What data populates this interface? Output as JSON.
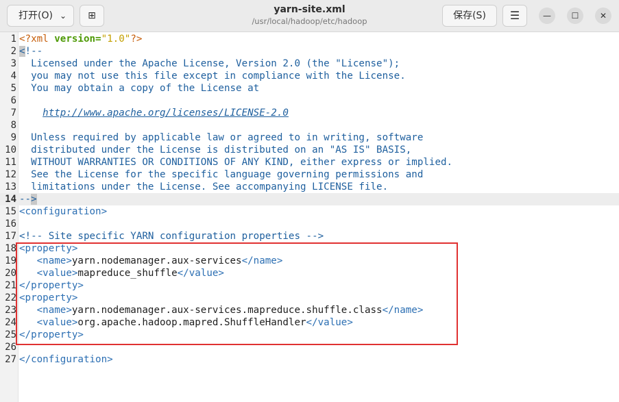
{
  "header": {
    "open_label": "打开(O)",
    "open_chevron": "⌄",
    "newtab_icon": "⊞",
    "title": "yarn-site.xml",
    "subtitle": "/usr/local/hadoop/etc/hadoop",
    "save_label": "保存(S)",
    "menu_icon": "☰",
    "minimize_icon": "—",
    "maximize_icon": "☐",
    "close_icon": "✕"
  },
  "editor": {
    "current_line": 14,
    "lines": [
      {
        "n": "1",
        "tokens": [
          {
            "t": "<?xml ",
            "c": "decl"
          },
          {
            "t": "version=",
            "c": "attr"
          },
          {
            "t": "\"1.0\"",
            "c": "val"
          },
          {
            "t": "?>",
            "c": "decl"
          }
        ]
      },
      {
        "n": "2",
        "tokens": [
          {
            "t": "<",
            "c": "bracket"
          },
          {
            "t": "!--",
            "c": "cmt"
          }
        ]
      },
      {
        "n": "3",
        "tokens": [
          {
            "t": "  Licensed under the Apache License, Version 2.0 (the \"License\");",
            "c": "cmt"
          }
        ]
      },
      {
        "n": "4",
        "tokens": [
          {
            "t": "  you may not use this file except in compliance with the License.",
            "c": "cmt"
          }
        ]
      },
      {
        "n": "5",
        "tokens": [
          {
            "t": "  You may obtain a copy of the License at",
            "c": "cmt"
          }
        ]
      },
      {
        "n": "6",
        "tokens": []
      },
      {
        "n": "7",
        "tokens": [
          {
            "t": "    ",
            "c": "cmt"
          },
          {
            "t": "http://www.apache.org/licenses/LICENSE-2.0",
            "c": "link"
          }
        ]
      },
      {
        "n": "8",
        "tokens": []
      },
      {
        "n": "9",
        "tokens": [
          {
            "t": "  Unless required by applicable law or agreed to in writing, software",
            "c": "cmt"
          }
        ]
      },
      {
        "n": "10",
        "tokens": [
          {
            "t": "  distributed under the License is distributed on an \"AS IS\" BASIS,",
            "c": "cmt"
          }
        ]
      },
      {
        "n": "11",
        "tokens": [
          {
            "t": "  WITHOUT WARRANTIES OR CONDITIONS OF ANY KIND, either express or implied.",
            "c": "cmt"
          }
        ]
      },
      {
        "n": "12",
        "tokens": [
          {
            "t": "  See the License for the specific language governing permissions and",
            "c": "cmt"
          }
        ]
      },
      {
        "n": "13",
        "tokens": [
          {
            "t": "  limitations under the License. See accompanying LICENSE file.",
            "c": "cmt"
          }
        ]
      },
      {
        "n": "14",
        "tokens": [
          {
            "t": "--",
            "c": "cmt"
          },
          {
            "t": ">",
            "c": "bracket"
          }
        ]
      },
      {
        "n": "15",
        "tokens": [
          {
            "t": "<configuration>",
            "c": "tag"
          }
        ]
      },
      {
        "n": "16",
        "tokens": []
      },
      {
        "n": "17",
        "tokens": [
          {
            "t": "<!-- Site specific YARN configuration properties -->",
            "c": "cmt"
          }
        ]
      },
      {
        "n": "18",
        "tokens": [
          {
            "t": "<property>",
            "c": "tag"
          }
        ]
      },
      {
        "n": "19",
        "tokens": [
          {
            "t": "   <name>",
            "c": "tag"
          },
          {
            "t": "yarn.nodemanager.aux-services",
            "c": "plain"
          },
          {
            "t": "</name>",
            "c": "tag"
          }
        ]
      },
      {
        "n": "20",
        "tokens": [
          {
            "t": "   <value>",
            "c": "tag"
          },
          {
            "t": "mapreduce_shuffle",
            "c": "plain"
          },
          {
            "t": "</value>",
            "c": "tag"
          }
        ]
      },
      {
        "n": "21",
        "tokens": [
          {
            "t": "</property>",
            "c": "tag"
          }
        ]
      },
      {
        "n": "22",
        "tokens": [
          {
            "t": "<property>",
            "c": "tag"
          }
        ]
      },
      {
        "n": "23",
        "tokens": [
          {
            "t": "   <name>",
            "c": "tag"
          },
          {
            "t": "yarn.nodemanager.aux-services.mapreduce.shuffle.class",
            "c": "plain"
          },
          {
            "t": "</name>",
            "c": "tag"
          }
        ]
      },
      {
        "n": "24",
        "tokens": [
          {
            "t": "   <value>",
            "c": "tag"
          },
          {
            "t": "org.apache.hadoop.mapred.ShuffleHandler",
            "c": "plain"
          },
          {
            "t": "</value>",
            "c": "tag"
          }
        ]
      },
      {
        "n": "25",
        "tokens": [
          {
            "t": "</property>",
            "c": "tag"
          }
        ]
      },
      {
        "n": "26",
        "tokens": []
      },
      {
        "n": "27",
        "tokens": [
          {
            "t": "</configuration>",
            "c": "tag"
          }
        ]
      }
    ]
  },
  "colors": {
    "highlight_box": "#e03131",
    "comment": "#1e5f9e",
    "tag": "#2c6fb3",
    "attribute": "#4e9a06",
    "string": "#c4a000"
  }
}
